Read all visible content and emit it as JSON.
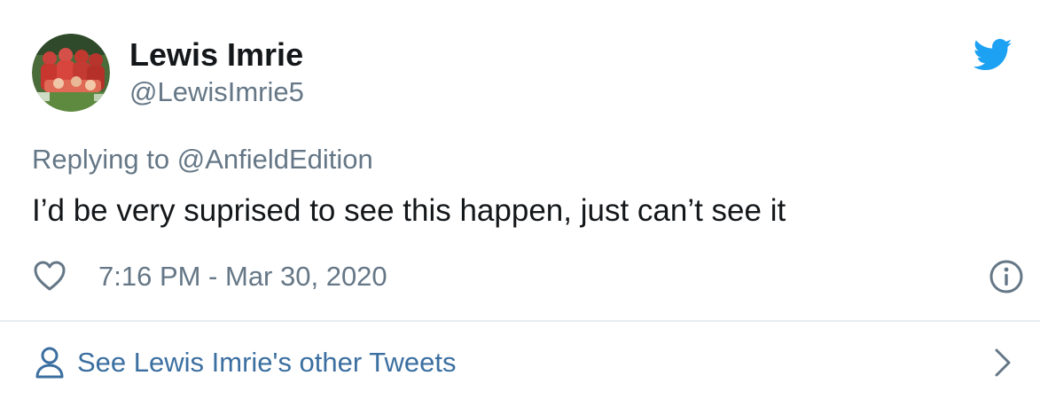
{
  "tweet": {
    "author": {
      "name": "Lewis Imrie",
      "handle": "@LewisImrie5"
    },
    "reply": {
      "prefix": "Replying to",
      "mention": "@AnfieldEdition"
    },
    "text": "I’d be very suprised to see this happen, just can’t see it",
    "timestamp": "7:16 PM - Mar 30, 2020"
  },
  "footer": {
    "label": "See Lewis Imrie's other Tweets"
  },
  "icons": {
    "brand": "twitter-bird-icon",
    "like": "heart-icon",
    "info": "info-icon",
    "profile": "user-icon",
    "next": "chevron-right-icon"
  },
  "colors": {
    "twitter_blue": "#1da1f2",
    "secondary_text": "#657786",
    "primary_text": "#14171a",
    "link": "#3b6fa0",
    "divider": "#e6ecf0"
  }
}
